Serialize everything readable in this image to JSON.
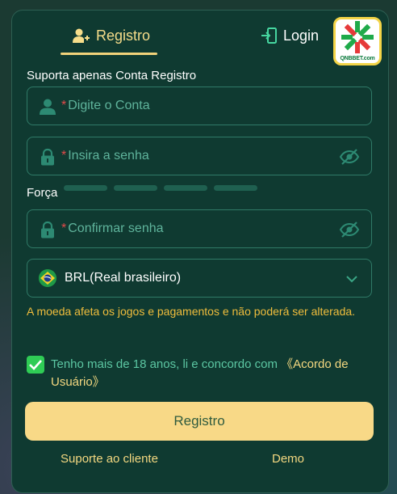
{
  "tabs": {
    "register_label": "Registro",
    "login_label": "Login"
  },
  "logo": {
    "text": "QNBBET.com"
  },
  "form": {
    "account_section_label": "Suporta apenas Conta Registro",
    "account_placeholder": "Digite o Conta",
    "password_placeholder": "Insira a senha",
    "strength_label": "Força",
    "confirm_placeholder": "Confirmar senha",
    "required_mark": "*",
    "currency_value": "BRL(Real brasileiro)",
    "currency_warning": "A moeda afeta os jogos e pagamentos e não poderá ser alterada.",
    "agree_text": "Tenho mais de 18 anos, li e concordo com ",
    "agree_link": "《Acordo de Usuário》",
    "submit_label": "Registro"
  },
  "footer": {
    "support_label": "Suporte ao cliente",
    "demo_label": "Demo"
  },
  "colors": {
    "accent": "#f8d987",
    "panel": "#0f3a31",
    "input_border": "#2f7a67",
    "placeholder": "#5fb49c",
    "warning": "#f0bd3c",
    "checkbox": "#2fcc55"
  },
  "icons": {
    "register_tab": "user-add-icon",
    "login_tab": "login-door-icon",
    "account_field": "user-icon",
    "password_field": "lock-icon",
    "password_toggle": "eye-slash-icon",
    "currency_flag": "brazil-flag-icon",
    "currency_dropdown": "chevron-down-icon",
    "checkbox": "check-icon"
  }
}
